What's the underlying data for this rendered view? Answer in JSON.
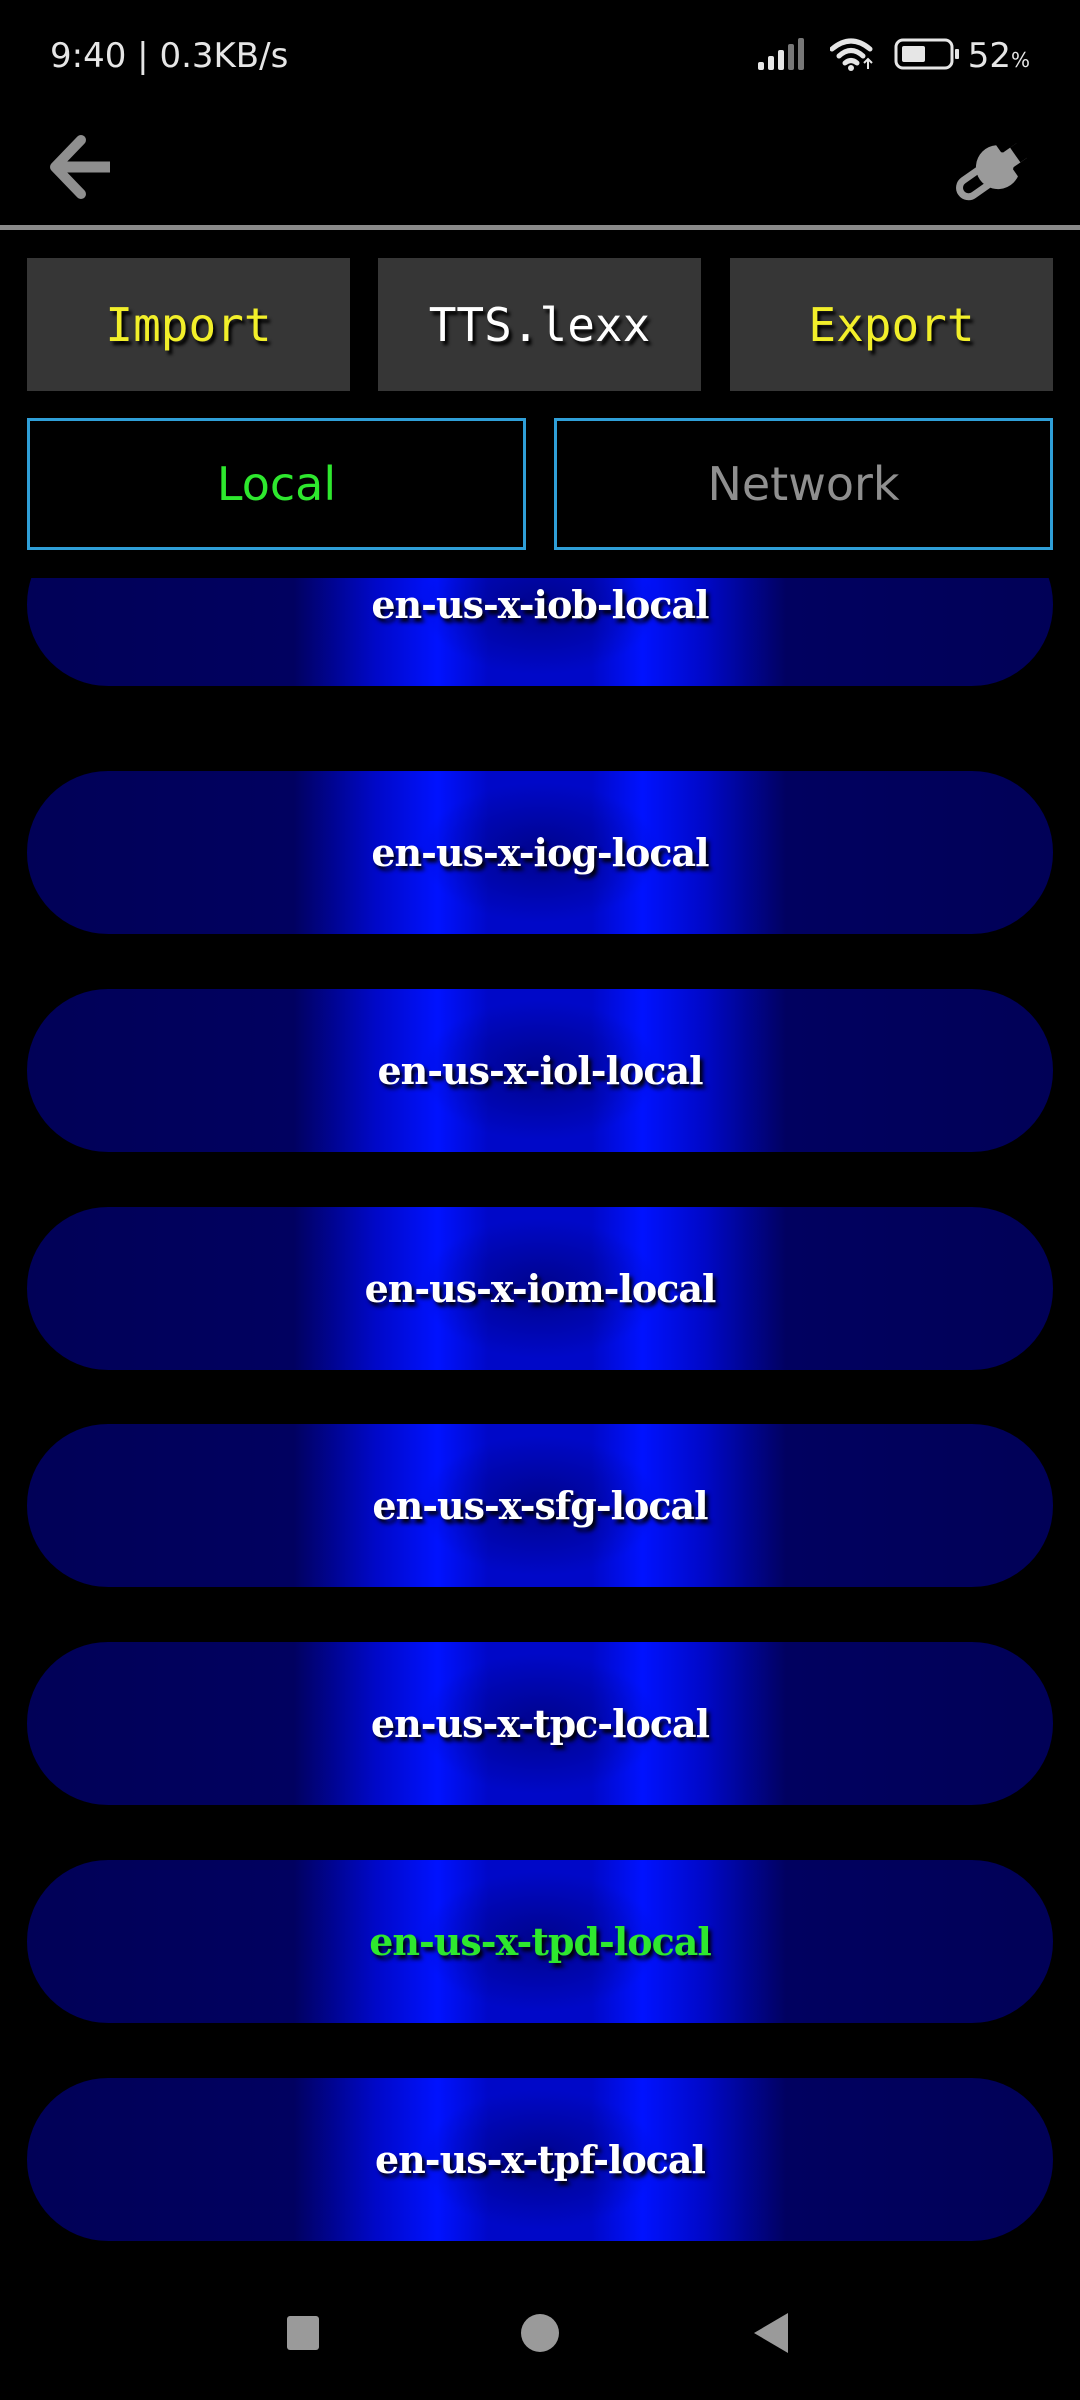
{
  "status_bar": {
    "time": "9:40",
    "separator": " | ",
    "network_speed": "0.3KB/s",
    "battery_percent": "52",
    "battery_percent_sign": "%",
    "battery_level": 0.52,
    "icons": [
      "cellular-signal-icon",
      "wifi-icon",
      "battery-icon"
    ]
  },
  "toolbar": {
    "back_icon": "arrow-left-icon",
    "settings_icon": "wrench-icon"
  },
  "actions": {
    "import_label": "Import",
    "file_label": "TTS.lexx",
    "export_label": "Export"
  },
  "tabs": [
    {
      "label": "Local",
      "selected": true
    },
    {
      "label": "Network",
      "selected": false
    }
  ],
  "voices": [
    {
      "label": "en-us-x-iob-local",
      "selected": false
    },
    {
      "label": "en-us-x-iog-local",
      "selected": false
    },
    {
      "label": "en-us-x-iol-local",
      "selected": false
    },
    {
      "label": "en-us-x-iom-local",
      "selected": false
    },
    {
      "label": "en-us-x-sfg-local",
      "selected": false
    },
    {
      "label": "en-us-x-tpc-local",
      "selected": false
    },
    {
      "label": "en-us-x-tpd-local",
      "selected": true
    },
    {
      "label": "en-us-x-tpf-local",
      "selected": false
    }
  ],
  "colors": {
    "accent_yellow": "#f2ef2a",
    "selected_green": "#2ee82e",
    "tab_border": "#2f9fd8",
    "button_bg": "#363636",
    "pill_dark_blue": "#010157",
    "pill_bright_blue": "#0012ff",
    "icon_gray": "#8f8f8f"
  },
  "nav_bar": {
    "icons": [
      "recents-square-icon",
      "home-circle-icon",
      "back-triangle-icon"
    ]
  }
}
